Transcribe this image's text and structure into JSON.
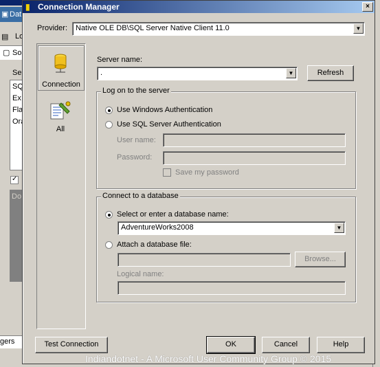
{
  "window": {
    "title": "Connection Manager",
    "close_label": "×"
  },
  "background": {
    "left_items": [
      "Dat",
      "Lo",
      "So",
      "Se",
      "SQ",
      "Ex",
      "Fla",
      "Ora",
      "Do"
    ],
    "bottom_text": "gers"
  },
  "provider": {
    "label": "Provider:",
    "value": "Native OLE DB\\SQL Server Native Client 11.0"
  },
  "sidenav": {
    "items": [
      {
        "label": "Connection",
        "icon": "database-cylinder-icon",
        "selected": true
      },
      {
        "label": "All",
        "icon": "properties-icon",
        "selected": false
      }
    ]
  },
  "server": {
    "label": "Server name:",
    "value": ".",
    "refresh_label": "Refresh"
  },
  "logon": {
    "group_title": "Log on to the server",
    "windows_auth_label": "Use Windows Authentication",
    "sql_auth_label": "Use SQL Server Authentication",
    "username_label": "User name:",
    "password_label": "Password:",
    "save_password_label": "Save my password",
    "selected": "windows"
  },
  "database": {
    "group_title": "Connect to a database",
    "select_label": "Select or enter a database name:",
    "db_value": "AdventureWorks2008",
    "attach_label": "Attach a database file:",
    "browse_label": "Browse...",
    "logical_name_label": "Logical name:",
    "selected": "select"
  },
  "footer": {
    "test_connection_label": "Test Connection",
    "ok_label": "OK",
    "cancel_label": "Cancel",
    "help_label": "Help"
  },
  "watermark": "Indiandotnet - A Microsoft User Community Group © 2015",
  "colors": {
    "titlebar_start": "#0a246a",
    "titlebar_end": "#a6caf0",
    "face": "#d4d0c8"
  }
}
